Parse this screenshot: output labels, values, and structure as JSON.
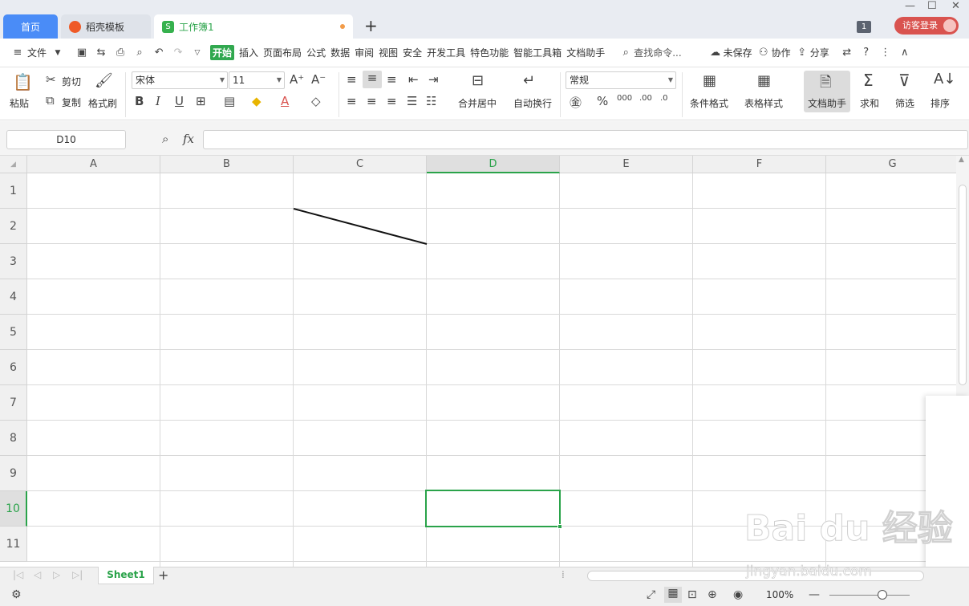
{
  "tabs": {
    "home": "首页",
    "template": "稻壳模板",
    "workbook": "工作簿1",
    "workbook_icon": "S"
  },
  "titlebar": {
    "badge": "1",
    "login": "访客登录"
  },
  "menu": {
    "file": "文件",
    "items": [
      "开始",
      "插入",
      "页面布局",
      "公式",
      "数据",
      "审阅",
      "视图",
      "安全",
      "开发工具",
      "特色功能",
      "智能工具箱",
      "文档助手"
    ],
    "search": "查找命令...",
    "unsaved": "未保存",
    "collab": "协作",
    "share": "分享"
  },
  "ribbon": {
    "paste": "粘贴",
    "cut": "剪切",
    "copy": "复制",
    "format_painter": "格式刷",
    "font_name": "宋体",
    "font_size": "11",
    "merge_center": "合并居中",
    "wrap_text": "自动换行",
    "number_format": "常规",
    "conditional_format": "条件格式",
    "table_style": "表格样式",
    "doc_assistant": "文档助手",
    "sum": "求和",
    "filter": "筛选",
    "sort": "排序"
  },
  "formula_bar": {
    "name_box": "D10",
    "fx": "fx",
    "value": ""
  },
  "grid": {
    "columns": [
      "A",
      "B",
      "C",
      "D",
      "E",
      "F",
      "G"
    ],
    "rows": [
      "1",
      "2",
      "3",
      "4",
      "5",
      "6",
      "7",
      "8",
      "9",
      "10",
      "11"
    ],
    "selected_column": "D",
    "selected_row": "10",
    "selected_cell": "D10"
  },
  "sheets": {
    "tabs": [
      "Sheet1"
    ],
    "active": "Sheet1"
  },
  "status": {
    "zoom": "100%"
  },
  "watermark": {
    "main": "Bai du 经验",
    "sub": "jingyan.baidu.com"
  }
}
